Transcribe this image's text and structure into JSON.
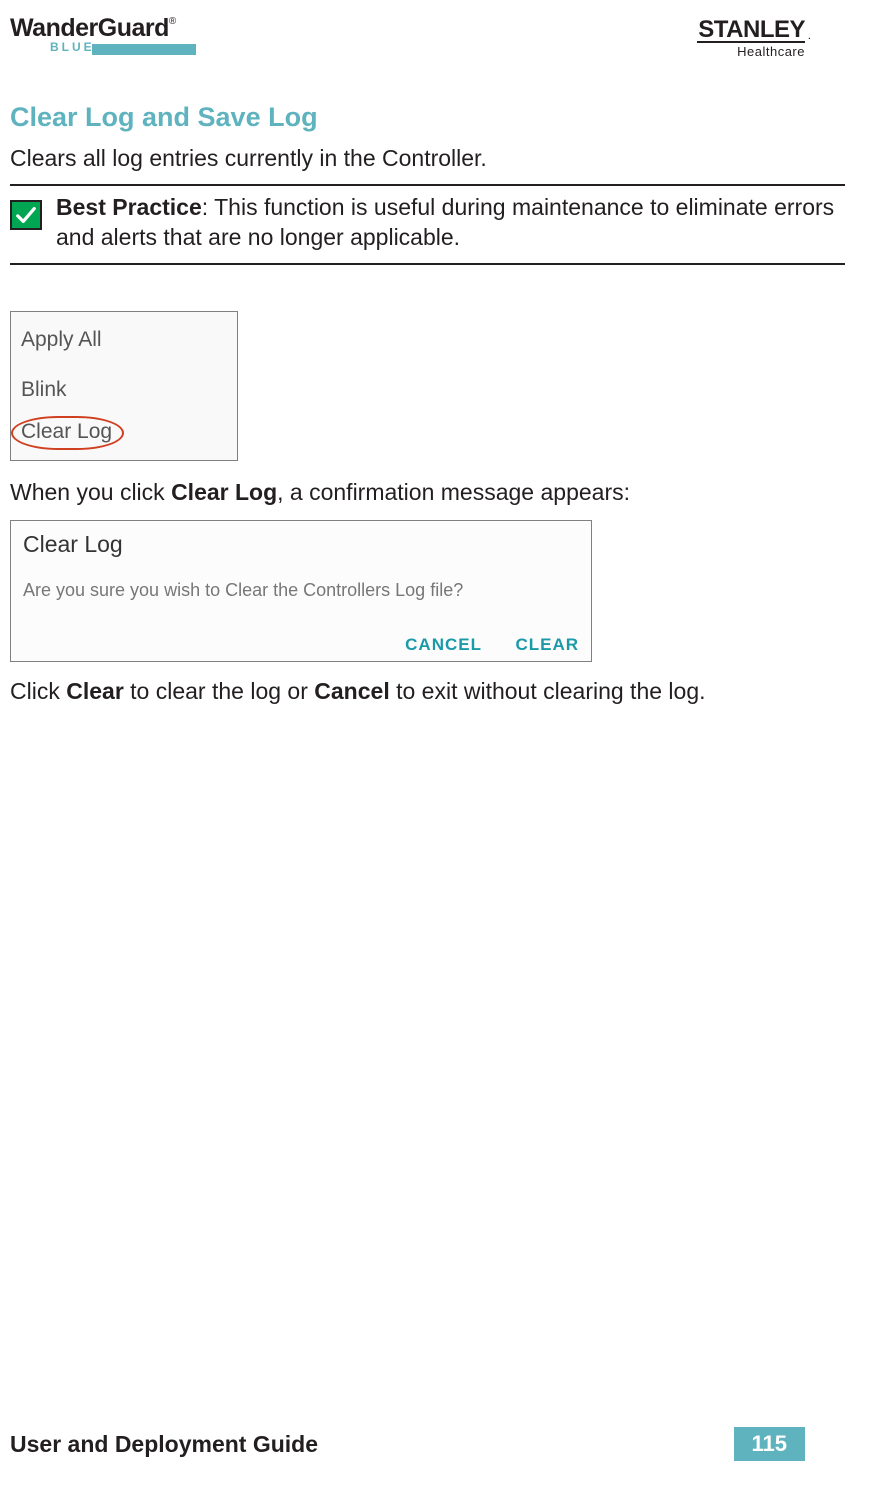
{
  "header": {
    "logo_main": "WanderGuard",
    "logo_reg": "®",
    "logo_sub": "BLUE",
    "stanley_main": "STANLEY",
    "stanley_dot": ".",
    "stanley_sub": "Healthcare"
  },
  "section_title": "Clear Log and Save Log",
  "intro": "Clears all log entries currently in the Controller.",
  "callout": {
    "label": "Best Practice",
    "text": ": This function is useful during maintenance to eliminate errors and alerts that are no longer applicable."
  },
  "fig1": {
    "item1": "Apply All",
    "item2": "Blink",
    "item3": "Clear Log"
  },
  "mid_pre": "When you click ",
  "mid_bold": "Clear Log",
  "mid_post": ", a confirmation message appears:",
  "fig2": {
    "title": "Clear Log",
    "message": "Are you sure you wish to Clear the Controllers Log file?",
    "cancel": "CANCEL",
    "clear": "CLEAR"
  },
  "bottom_p1": "Click ",
  "bottom_b1": "Clear",
  "bottom_p2": " to clear the log or ",
  "bottom_b2": "Cancel",
  "bottom_p3": " to exit without clearing the log.",
  "footer": {
    "title": "User and Deployment Guide",
    "page": "115"
  }
}
